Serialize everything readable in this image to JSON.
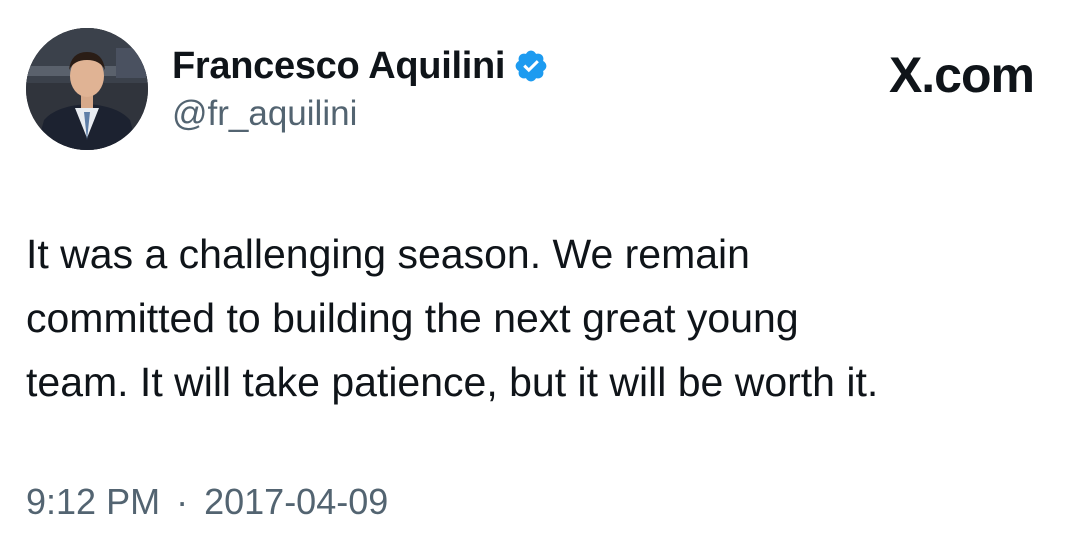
{
  "author": {
    "display_name": "Francesco Aquilini",
    "handle": "@fr_aquilini",
    "verified": true,
    "avatar_icon": "profile-photo"
  },
  "brand": {
    "logo_text": "X.com"
  },
  "tweet": {
    "lines": [
      "It was a challenging season. We remain",
      "committed to building the next great young",
      "team. It will take patience, but it will be worth it."
    ]
  },
  "meta": {
    "time": "9:12 PM",
    "separator": "·",
    "date": "2017-04-09"
  },
  "colors": {
    "text": "#0f1419",
    "secondary_text": "#536471",
    "verified_badge": "#1d9bf0",
    "background": "#ffffff"
  }
}
